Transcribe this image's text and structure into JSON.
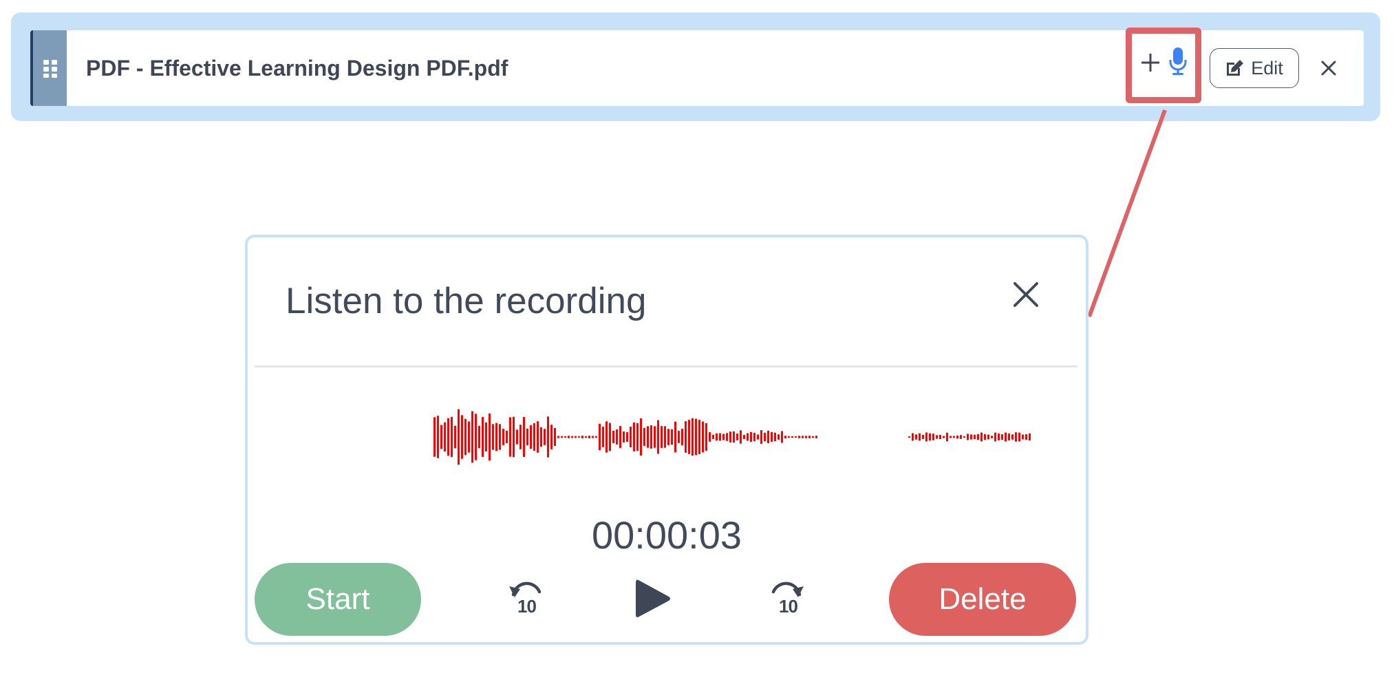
{
  "file_item": {
    "name": "PDF - Effective Learning Design PDF.pdf",
    "add_audio_symbol": "+",
    "edit_label": "Edit",
    "icons": {
      "drag": "drag-handle-icon",
      "mic": "microphone-icon",
      "edit": "edit-icon",
      "close": "close-icon"
    }
  },
  "recording_dialog": {
    "title": "Listen to the recording",
    "timer": "00:00:03",
    "start_label": "Start",
    "delete_label": "Delete",
    "skip_back_label": "10",
    "skip_forward_label": "10",
    "icons": {
      "close": "close-icon",
      "skip_back": "rewind-10-icon",
      "play": "play-icon",
      "skip_forward": "forward-10-icon"
    }
  },
  "colors": {
    "highlight_box": "#dc6366",
    "waveform": "#ff0000",
    "start_button": "#82c09c",
    "delete_button": "#dd615f",
    "panel_accent": "#c7e1f8",
    "mic": "#3b82f6"
  }
}
